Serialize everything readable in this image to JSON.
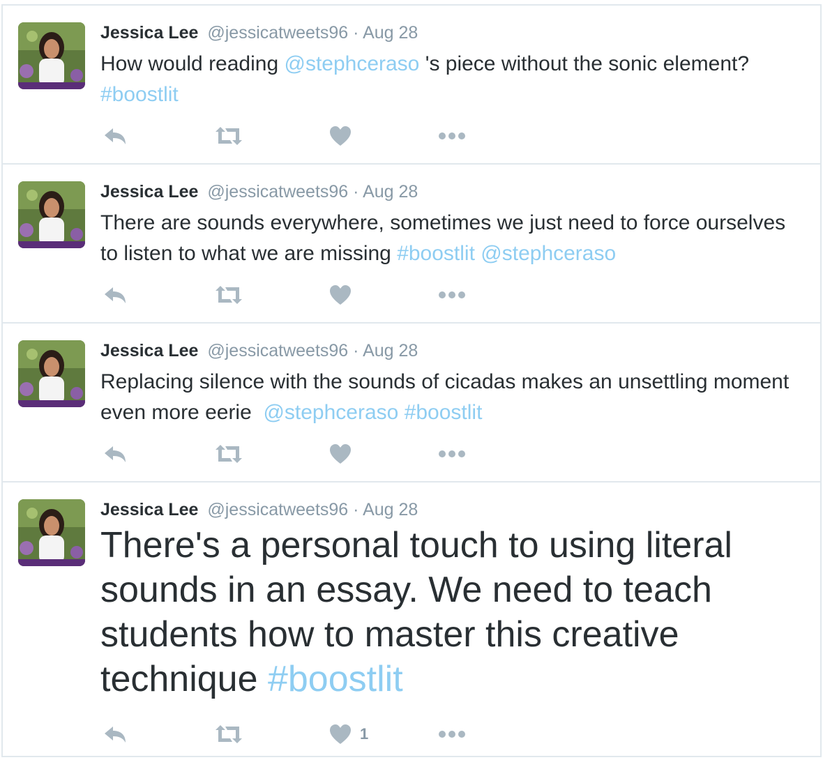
{
  "colors": {
    "text": "#292f33",
    "secondary": "#8899a6",
    "link": "#8ecdf2",
    "icon": "#aab8c2",
    "border": "#e1e8ed"
  },
  "icons": {
    "reply": "reply-icon",
    "retweet": "retweet-icon",
    "like": "heart-icon",
    "more": "more-dots-icon"
  },
  "tweets": [
    {
      "name": "Jessica Lee",
      "handle": "@jessicatweets96",
      "separator": "·",
      "date": "Aug 28",
      "text_1": "How would reading ",
      "mention": "@stephceraso",
      "text_2": " 's piece without the sonic element? ",
      "hashtag": "#boostlit"
    },
    {
      "name": "Jessica Lee",
      "handle": "@jessicatweets96",
      "separator": "·",
      "date": "Aug 28",
      "text_1": "There are sounds everywhere, sometimes we just need to force ourselves to listen to what we are missing ",
      "hashtag": "#boostlit",
      "space": " ",
      "mention": "@stephceraso"
    },
    {
      "name": "Jessica Lee",
      "handle": "@jessicatweets96",
      "separator": "·",
      "date": "Aug 28",
      "text_1": "Replacing silence with the sounds of cicadas makes an unsettling moment even more eerie  ",
      "mention": "@stephceraso",
      "space": " ",
      "hashtag": "#boostlit"
    },
    {
      "name": "Jessica Lee",
      "handle": "@jessicatweets96",
      "separator": "·",
      "date": "Aug 28",
      "text_1": "There's a personal touch to using literal sounds in an essay. We need to teach students how to master this creative technique ",
      "hashtag": "#boostlit",
      "like_count": "1"
    }
  ]
}
